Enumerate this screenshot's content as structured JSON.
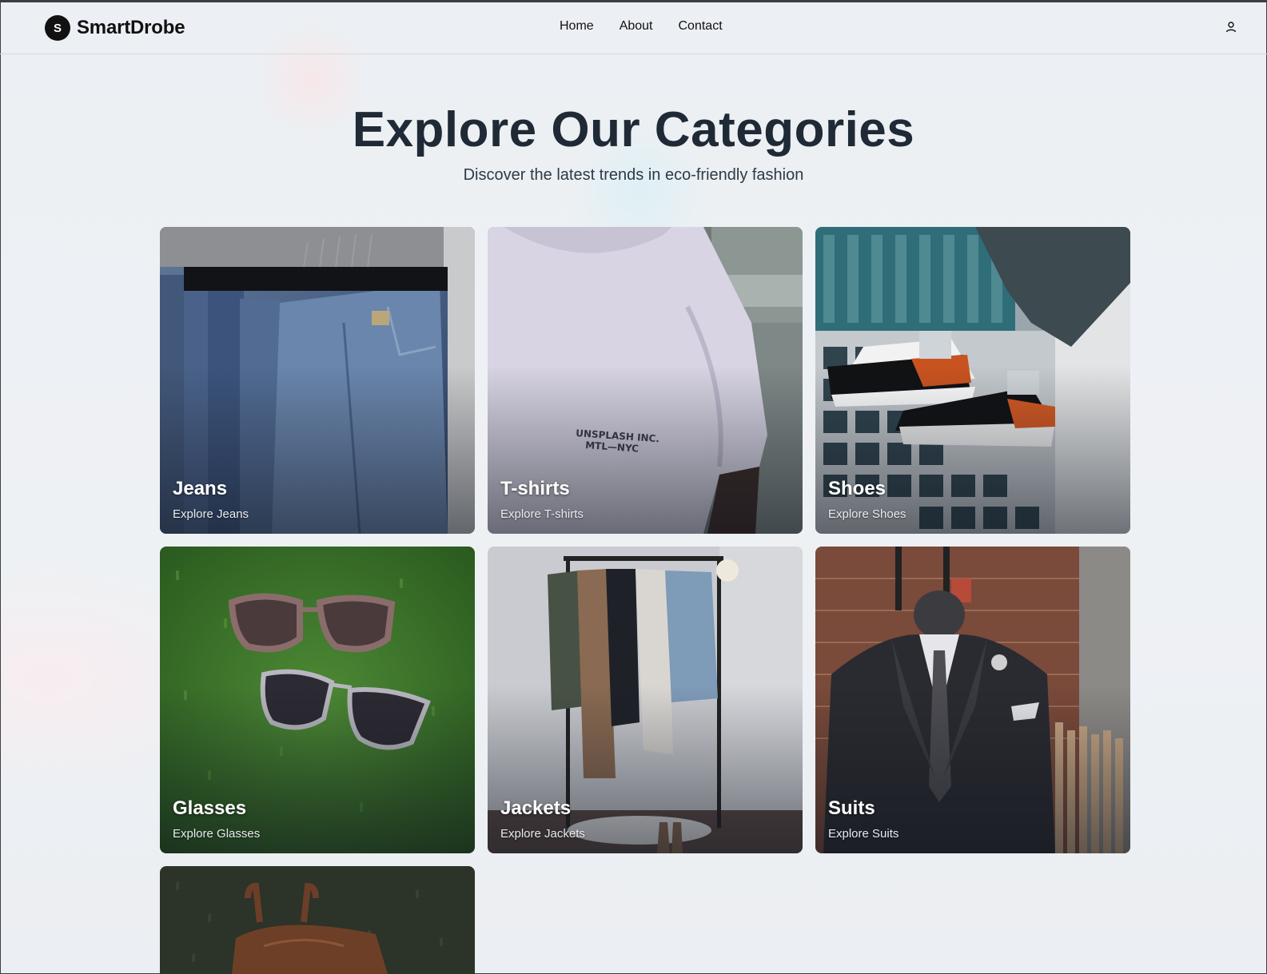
{
  "header": {
    "logo_letter": "S",
    "brand": "SmartDrobe",
    "nav": [
      {
        "label": "Home"
      },
      {
        "label": "About"
      },
      {
        "label": "Contact"
      }
    ],
    "user_icon": "user-icon"
  },
  "hero": {
    "title": "Explore Our Categories",
    "subtitle": "Discover the latest trends in eco-friendly fashion"
  },
  "categories": [
    {
      "title": "Jeans",
      "link": "Explore Jeans",
      "image": "jeans-photo"
    },
    {
      "title": "T-shirts",
      "link": "Explore T-shirts",
      "image": "tshirt-photo",
      "print_text": "UNSPLASH INC.\nMTL—NYC"
    },
    {
      "title": "Shoes",
      "link": "Explore Shoes",
      "image": "shoes-photo"
    },
    {
      "title": "Glasses",
      "link": "Explore Glasses",
      "image": "glasses-photo"
    },
    {
      "title": "Jackets",
      "link": "Explore Jackets",
      "image": "jackets-photo"
    },
    {
      "title": "Suits",
      "link": "Explore Suits",
      "image": "suits-photo"
    },
    {
      "title": "",
      "link": "",
      "image": "bags-photo"
    }
  ]
}
